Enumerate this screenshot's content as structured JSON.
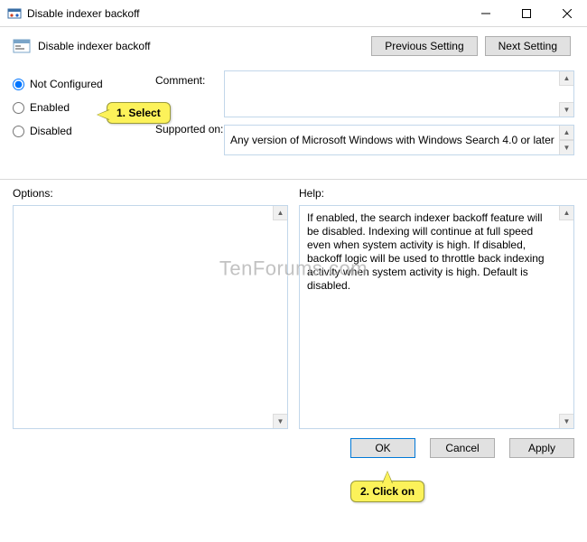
{
  "titlebar": {
    "title": "Disable indexer backoff"
  },
  "header": {
    "title": "Disable indexer backoff"
  },
  "nav": {
    "previous": "Previous Setting",
    "next": "Next Setting"
  },
  "radios": {
    "not_configured": "Not Configured",
    "enabled": "Enabled",
    "disabled": "Disabled"
  },
  "labels": {
    "comment": "Comment:",
    "supported": "Supported on:",
    "options": "Options:",
    "help": "Help:"
  },
  "comment": "",
  "supported_on": "Any version of Microsoft Windows with Windows Search 4.0 or later",
  "help_text": "If enabled, the search indexer backoff feature will be disabled. Indexing will continue at full speed even when system activity is high. If disabled, backoff logic will be used to throttle back indexing activity when system activity is high. Default is disabled.",
  "buttons": {
    "ok": "OK",
    "cancel": "Cancel",
    "apply": "Apply"
  },
  "callouts": {
    "select": "1. Select",
    "click": "2. Click on"
  },
  "watermark": "TenForums.com"
}
